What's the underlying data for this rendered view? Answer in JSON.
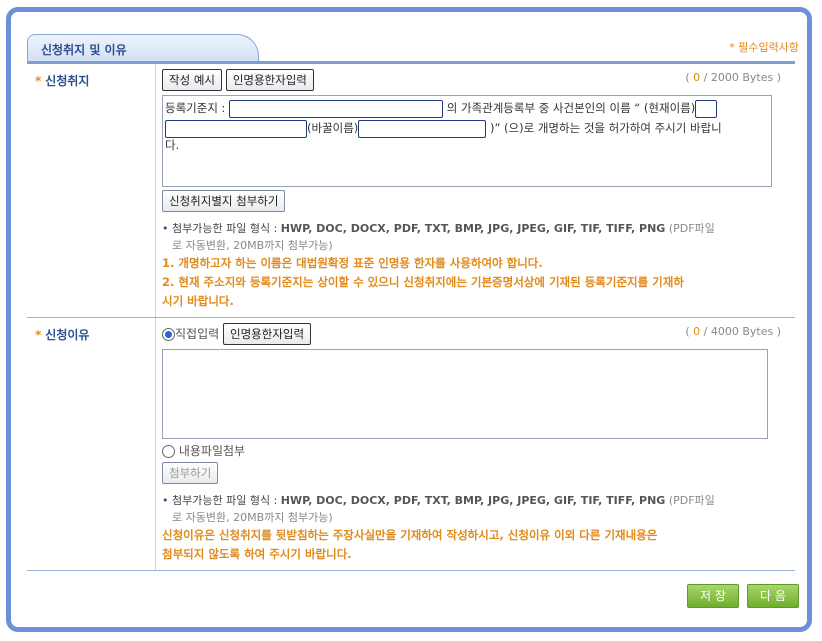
{
  "section": {
    "tab_title": "신청취지 및 이유",
    "required_note": "* 필수입력사항"
  },
  "purpose": {
    "label": "신청취지",
    "example_button": "작성 예시",
    "hanja_button": "인명용한자입력",
    "byte_count": "0",
    "byte_max": "/ 2000 Bytes",
    "line1_prefix": "등록기준지 :",
    "line1_mid": "의 가족관계등록부 중 사건본인의 이름 “ (현재이름)",
    "line2_mid": "(바꿀이름)",
    "line2_suffix": ")” (으)로 개명하는 것을 허가하여 주시기 바랍니",
    "line3": "다.",
    "attach_button": "신청취지별지 첨부하기",
    "format_label": "첨부가능한 파일 형식 :",
    "formats": "HWP, DOC, DOCX, PDF, TXT, BMP, JPG, JPEG, GIF, TIF, TIFF, PNG",
    "format_note_a": "(PDF파일",
    "format_note_b": "로 자동변환, 20MB까지 첨부가능)",
    "warn1": "1. 개명하고자 하는 이름은 대법원확정 표준 인명용 한자를 사용하여야 합니다.",
    "warn2a": "2. 현재 주소지와 등록기준지는 상이할 수 있으니 신청취지에는 기본증명서상에 기재된 등록기준지를 기재하",
    "warn2b": "시기 바랍니다."
  },
  "reason": {
    "label": "신청이유",
    "direct_label": "직접입력",
    "hanja_button": "인명용한자입력",
    "byte_count": "0",
    "byte_max": "/ 4000 Bytes",
    "file_label": "내용파일첨부",
    "attach_button": "첨부하기",
    "format_label": "첨부가능한 파일 형식 :",
    "formats": "HWP, DOC, DOCX, PDF, TXT, BMP, JPG, JPEG, GIF, TIF, TIFF, PNG",
    "format_note_a": "(PDF파일",
    "format_note_b": "로 자동변환, 20MB까지 첨부가능)",
    "warn1": "신청이유은 신청취지를 뒷받침하는 주장사실만을 기재하여 작성하시고, 신청이유 이외 다른 기재내용은",
    "warn2": "첨부되지 않도록 하여 주시기 바랍니다."
  },
  "footer": {
    "save": "저 장",
    "next": "다 음"
  },
  "colors": {
    "accent": "#6f8fdc",
    "warning": "#e28a1a",
    "green": "#6eae2c"
  }
}
